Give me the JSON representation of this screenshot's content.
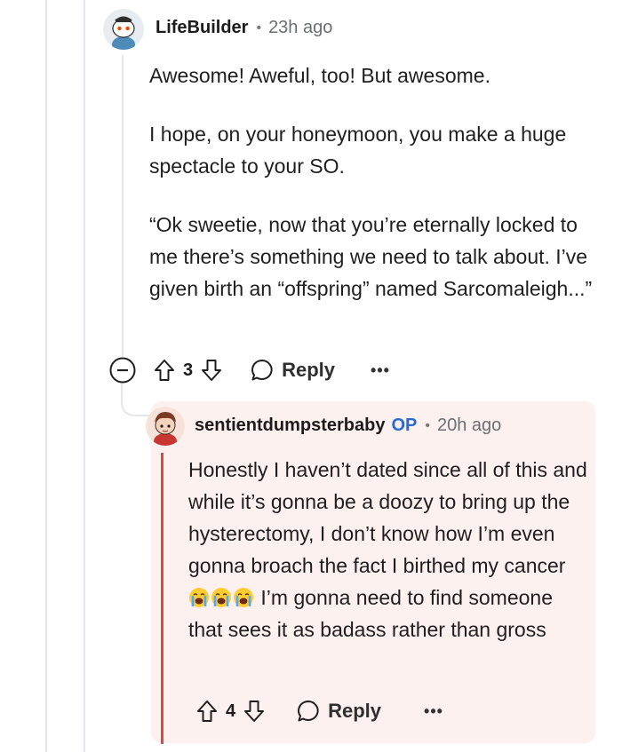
{
  "comments": {
    "top": {
      "username": "LifeBuilder",
      "separator": "•",
      "time": "23h ago",
      "paragraphs": [
        "Awesome! Aweful, too! But awesome.",
        "I hope, on your honeymoon, you make a huge spectacle to your SO.",
        "“Ok sweetie, now that you’re eternally locked to me there’s something we need to talk about. I’ve given birth an “offspring” named Sarcomaleigh...”"
      ],
      "votes": "3",
      "reply_label": "Reply",
      "more_label": "•••"
    },
    "reply": {
      "username": "sentientdumpsterbaby",
      "op_badge": "OP",
      "separator": "•",
      "time": "20h ago",
      "text_before_emoji": "Honestly I haven’t dated since all of this and while it’s gonna be a doozy to bring up the hysterectomy, I don’t know how I’m even gonna broach the fact I birthed my cancer",
      "emoji_name": "crying-face-emoji",
      "emoji_count": 3,
      "text_after_emoji": " I’m gonna need to find someone that sees it as badass rather than gross",
      "votes": "4",
      "reply_label": "Reply",
      "more_label": "•••"
    }
  },
  "colors": {
    "op": "#2a6bd1",
    "highlight": "#e0483f",
    "reply_bg": "#fdf1ef",
    "thread_line": "#e4e7ea"
  }
}
